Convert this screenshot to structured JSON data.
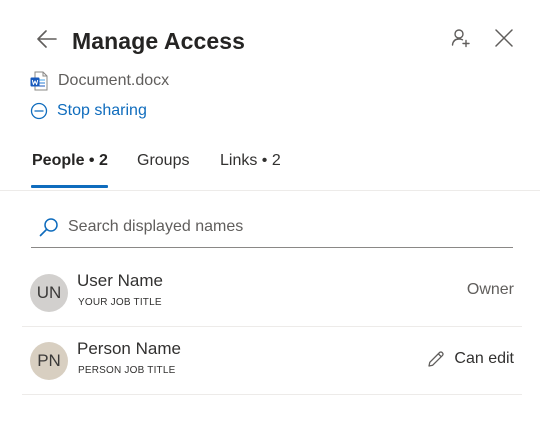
{
  "header": {
    "title": "Manage Access",
    "back_icon": "arrow-left-icon",
    "add_person_icon": "person-add-icon",
    "close_icon": "close-icon"
  },
  "file": {
    "name": "Document.docx",
    "icon": "word-document-icon"
  },
  "stop_sharing": {
    "label": "Stop sharing",
    "icon": "minus-circle-icon"
  },
  "tabs": [
    {
      "label": "People • 2",
      "active": true
    },
    {
      "label": "Groups",
      "active": false
    },
    {
      "label": "Links • 2",
      "active": false
    }
  ],
  "search": {
    "placeholder": "Search displayed names",
    "value": ""
  },
  "people": [
    {
      "initials": "UN",
      "name": "User Name",
      "job_title": "YOUR JOB TITLE",
      "role": "Owner",
      "avatar_color": "#d2d0ce"
    },
    {
      "initials": "PN",
      "name": "Person Name",
      "job_title": "PERSON JOB TITLE",
      "role": "Can edit",
      "role_icon": "pencil-icon",
      "avatar_color": "#d8cfc1"
    }
  ],
  "colors": {
    "accent": "#0f6cbd",
    "word_blue": "#185abd"
  }
}
